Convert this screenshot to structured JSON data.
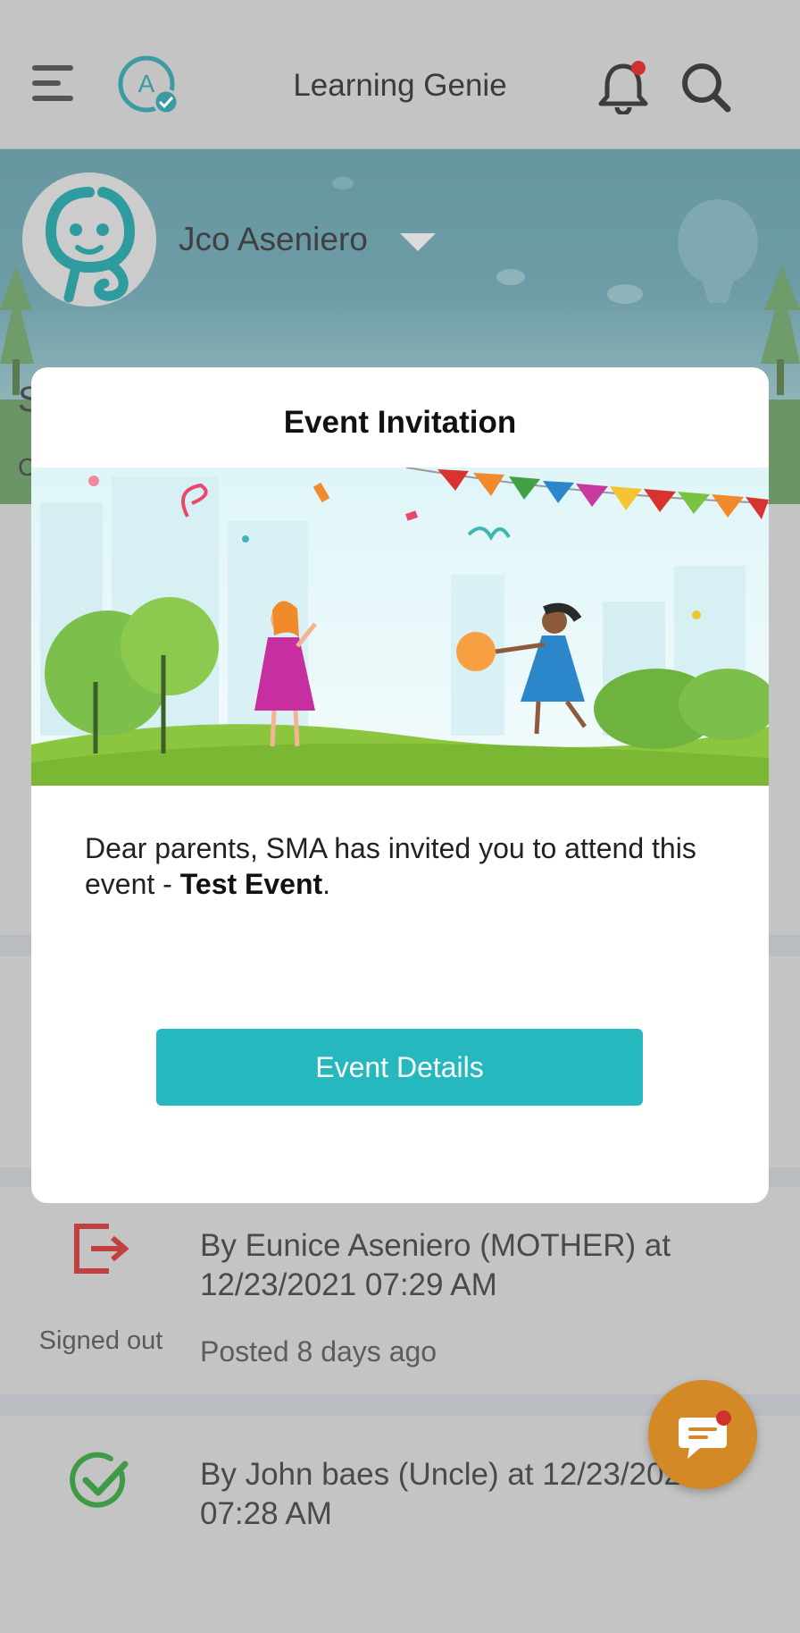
{
  "app": {
    "title": "Learning Genie"
  },
  "profile": {
    "child_name": "Jco Aseniero"
  },
  "banner": {
    "left_text_1": "S",
    "left_text_2": "C"
  },
  "modal": {
    "title": "Event Invitation",
    "message_prefix": "Dear parents, SMA has invited you to attend this event - ",
    "event_name": "Test Event",
    "message_suffix": ".",
    "button_label": "Event Details"
  },
  "feed": {
    "items": [
      {
        "status": "Signed out",
        "text": "By Eunice Aseniero (MOTHER) at 12/23/2021 07:29 AM",
        "posted": "Posted 8 days ago",
        "icon": "sign-out-icon"
      },
      {
        "status": "",
        "text": "By John baes (Uncle) at 12/23/2021 07:28 AM",
        "posted": "",
        "icon": "check-circle-icon"
      }
    ]
  },
  "colors": {
    "accent": "#26b8bf",
    "overlay": "#c4c4c4",
    "fab": "#d38a26",
    "notification_dot": "#d22f2f",
    "signout": "#c2403f",
    "check": "#3f9a46"
  }
}
